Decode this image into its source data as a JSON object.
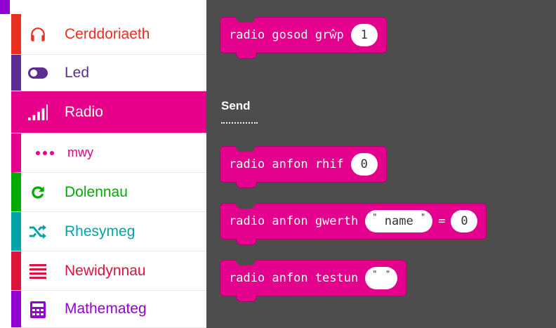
{
  "sidebar": {
    "items": [
      {
        "label": "Cerddoriaeth",
        "color": "#e63022",
        "icon": "headphones-icon"
      },
      {
        "label": "Led",
        "color": "#5c2d91",
        "icon": "toggle-icon"
      },
      {
        "label": "Radio",
        "color": "#e3008c",
        "icon": "signal-bars-icon",
        "selected": true
      },
      {
        "label": "mwy",
        "color": "#e3008c",
        "icon": "more-dots-icon",
        "sub": true
      },
      {
        "label": "Dolennau",
        "color": "#00aa00",
        "icon": "loop-refresh-icon"
      },
      {
        "label": "Rhesymeg",
        "color": "#00a4a6",
        "icon": "shuffle-icon"
      },
      {
        "label": "Newidynnau",
        "color": "#dc143c",
        "icon": "variables-lines-icon"
      },
      {
        "label": "Mathemateg",
        "color": "#9400d3",
        "icon": "calculator-icon"
      }
    ]
  },
  "workspace": {
    "block_color": "#e3008c",
    "blocks": {
      "set_group": {
        "text": "radio gosod grŵp",
        "value": "1"
      },
      "send_number": {
        "text": "radio anfon rhif",
        "value": "0"
      },
      "send_value": {
        "text": "radio anfon gwerth",
        "name": "name",
        "equals": "=",
        "value": "0"
      },
      "send_string": {
        "text": "radio anfon testun",
        "value": ""
      }
    },
    "section_label": "Send"
  }
}
